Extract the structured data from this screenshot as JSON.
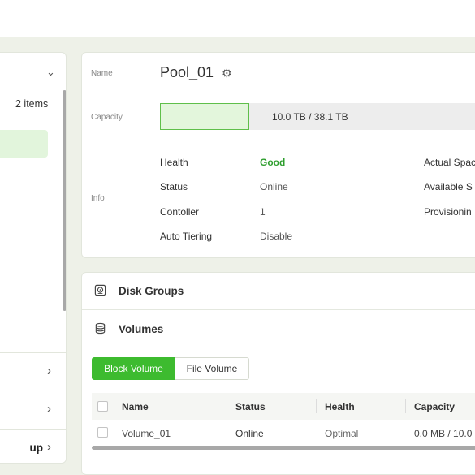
{
  "left_panel": {
    "count_text": "2 items",
    "rows": [
      {
        "label": ""
      },
      {
        "label": ""
      },
      {
        "label": "up"
      }
    ]
  },
  "pool": {
    "name_label": "Name",
    "name": "Pool_01",
    "capacity_label": "Capacity",
    "capacity_text": "10.0 TB / 38.1 TB",
    "capacity_used_fraction": 0.262,
    "info_label": "Info",
    "info": [
      {
        "key": "Health",
        "value": "Good"
      },
      {
        "key": "Status",
        "value": "Online"
      },
      {
        "key": "Contoller",
        "value": "1"
      },
      {
        "key": "Auto Tiering",
        "value": "Disable"
      }
    ],
    "right_keys": [
      "Actual Spac",
      "Available S",
      "Provisionin"
    ]
  },
  "sections": {
    "disk_groups": "Disk Groups",
    "volumes": "Volumes"
  },
  "volume_tabs": {
    "block": "Block Volume",
    "file": "File Volume"
  },
  "table": {
    "headers": [
      "Name",
      "Status",
      "Health",
      "Capacity"
    ],
    "rows": [
      {
        "name": "Volume_01",
        "status": "Online",
        "health": "Optimal",
        "capacity": "0.0 MB / 10.0"
      }
    ]
  },
  "colors": {
    "accent": "#3dbb2f",
    "good": "#2e9e2e",
    "capacity_fill": "#e3f6dc"
  }
}
